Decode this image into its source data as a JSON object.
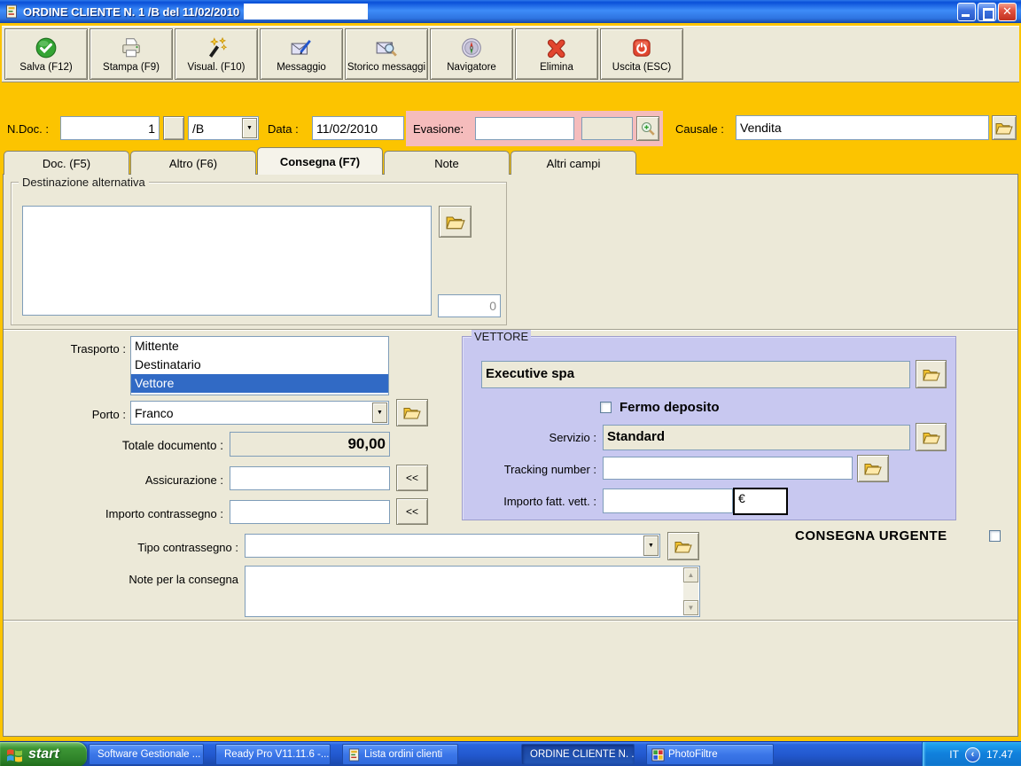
{
  "window": {
    "title": "ORDINE CLIENTE N. 1 /B del 11/02/2010"
  },
  "toolbar": {
    "buttons": [
      {
        "label": "Salva (F12)",
        "icon": "save-check-icon"
      },
      {
        "label": "Stampa (F9)",
        "icon": "printer-icon"
      },
      {
        "label": "Visual. (F10)",
        "icon": "magic-wand-icon"
      },
      {
        "label": "Messaggio",
        "icon": "envelope-pen-icon"
      },
      {
        "label": "Storico messaggi",
        "icon": "envelope-search-icon"
      },
      {
        "label": "Navigatore",
        "icon": "compass-icon"
      },
      {
        "label": "Elimina",
        "icon": "delete-x-icon"
      },
      {
        "label": "Uscita (ESC)",
        "icon": "power-icon"
      }
    ]
  },
  "header_fields": {
    "ndoc_label": "N.Doc. :",
    "ndoc_value": "1",
    "series_value": "/B",
    "data_label": "Data :",
    "data_value": "11/02/2010",
    "evasione_label": "Evasione:",
    "evasione_value": "",
    "causale_label": "Causale :",
    "causale_value": "Vendita"
  },
  "tabs": {
    "items": [
      {
        "label": "Doc. (F5)"
      },
      {
        "label": "Altro (F6)"
      },
      {
        "label": "Consegna (F7)"
      },
      {
        "label": "Note"
      },
      {
        "label": "Altri campi"
      }
    ],
    "active": "Consegna (F7)"
  },
  "destinazione": {
    "group_label": "Destinazione alternativa",
    "text": "",
    "counter_value": "0"
  },
  "trasporto": {
    "label": "Trasporto :",
    "options": [
      "Mittente",
      "Destinatario",
      "Vettore"
    ],
    "selected": "Vettore",
    "porto_label": "Porto :",
    "porto_value": "Franco",
    "totale_label": "Totale documento :",
    "totale_value": "90,00",
    "assicurazione_label": "Assicurazione :",
    "importo_contrassegno_label": "Importo contrassegno :",
    "recall_button": "<<",
    "tipo_contrassegno_label": "Tipo contrassegno :",
    "tipo_contrassegno_value": "",
    "note_consegna_label": "Note per la consegna",
    "note_consegna_value": ""
  },
  "vettore": {
    "group_label": "VETTORE",
    "nome_value": "Executive spa",
    "fermo_deposito_label": "Fermo deposito",
    "fermo_deposito_checked": false,
    "servizio_label": "Servizio :",
    "servizio_value": "Standard",
    "tracking_label": "Tracking number :",
    "tracking_value": "",
    "importo_fatt_label": "Importo fatt. vett. :",
    "importo_fatt_value": "",
    "currency_symbol": "€"
  },
  "consegna_urgente": {
    "label": "CONSEGNA URGENTE",
    "checked": false
  },
  "taskbar": {
    "start_label": "start",
    "tasks": [
      {
        "label": "Software Gestionale ...",
        "icon": "firefox-icon",
        "active": false
      },
      {
        "label": "Ready Pro V11.11.6 -...",
        "icon": "strawberry-icon",
        "active": false
      },
      {
        "label": "Lista ordini clienti",
        "icon": "document-icon",
        "active": false
      },
      {
        "label": "ORDINE CLIENTE N. ...",
        "icon": "document-icon",
        "active": true
      },
      {
        "label": "PhotoFiltre",
        "icon": "photofiltre-icon",
        "active": false
      }
    ],
    "tray": {
      "language": "IT",
      "time": "17.47"
    }
  },
  "colors": {
    "gold": "#FCC400",
    "beige": "#ECE9D8",
    "lavender": "#C8C8F0",
    "pink": "#F5BCBC",
    "selection_blue": "#316AC5",
    "titlebar_blue": "#2E73E0"
  }
}
